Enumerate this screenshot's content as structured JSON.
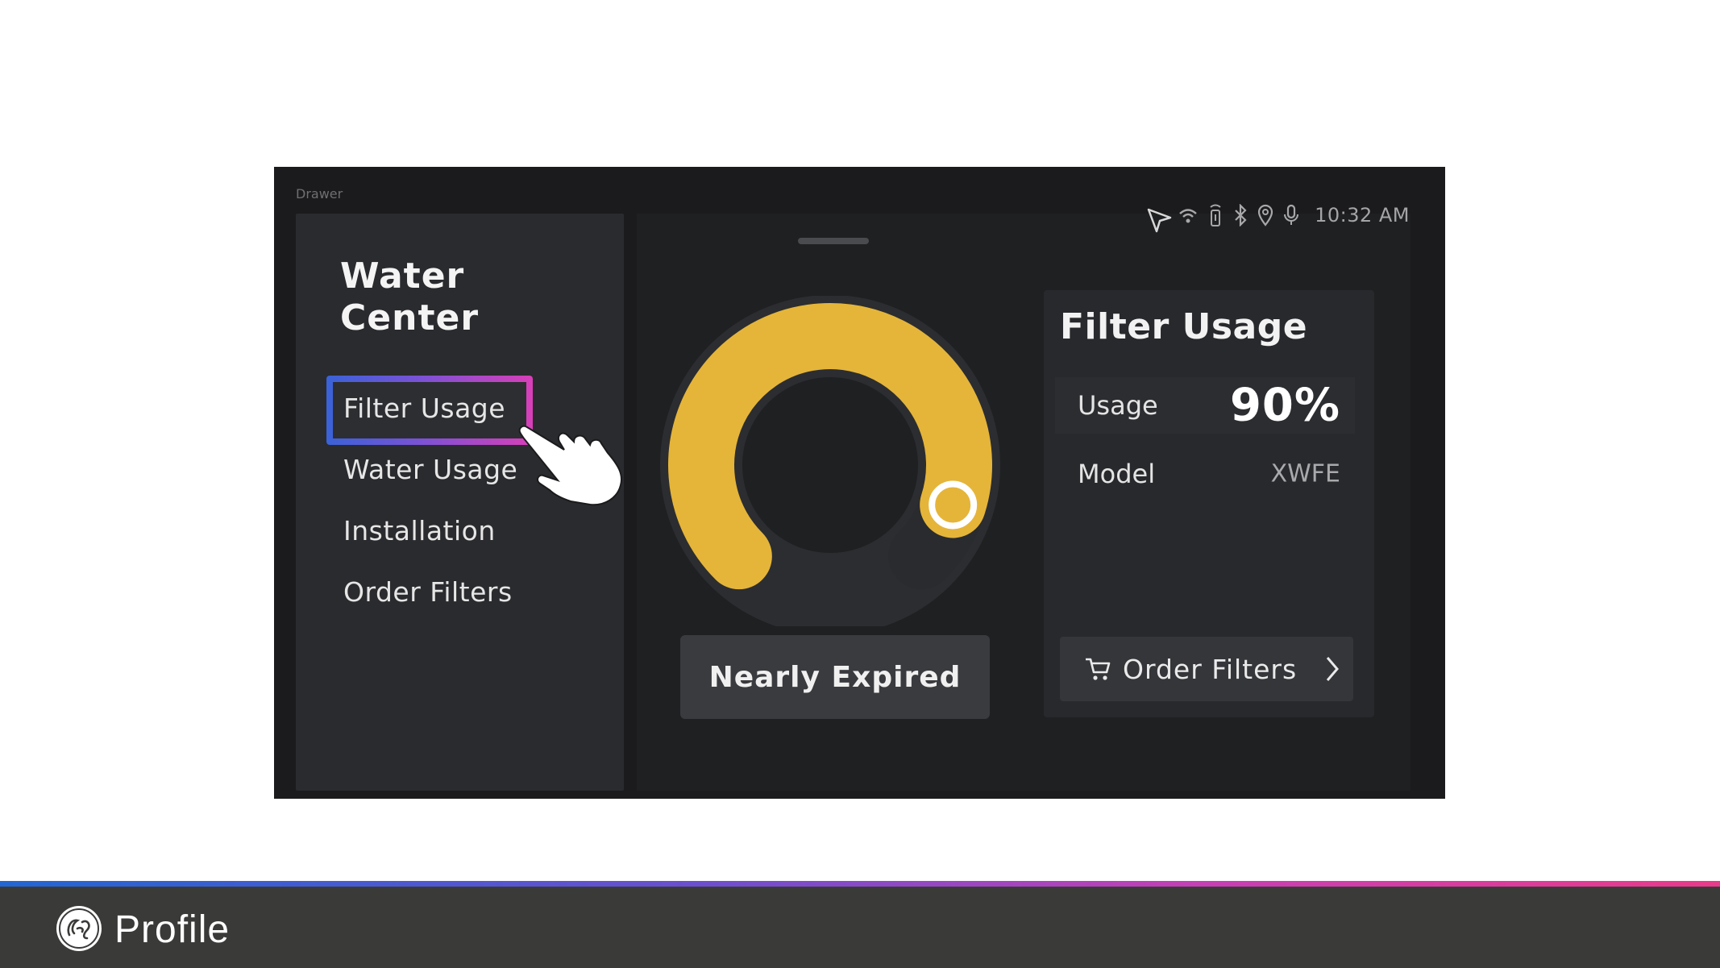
{
  "drawer_label": "Drawer",
  "sidebar": {
    "title": "Water Center",
    "items": [
      {
        "label": "Filter Usage",
        "active": true
      },
      {
        "label": "Water Usage",
        "active": false
      },
      {
        "label": "Installation",
        "active": false
      },
      {
        "label": "Order Filters",
        "active": false
      }
    ]
  },
  "status_bar": {
    "icons": [
      "wifi-icon",
      "remote-icon",
      "bluetooth-icon",
      "location-icon",
      "microphone-icon"
    ],
    "time": "10:32 AM"
  },
  "gauge": {
    "usage_fraction": 0.9,
    "color": "#e5b53a",
    "status_label": "Nearly Expired"
  },
  "filter_card": {
    "title": "Filter Usage",
    "usage_label": "Usage",
    "usage_value": "90%",
    "model_label": "Model",
    "model_value": "XWFE",
    "order_button_label": "Order Filters"
  },
  "footer": {
    "brand": "Profile",
    "logo": "ge-logo"
  }
}
